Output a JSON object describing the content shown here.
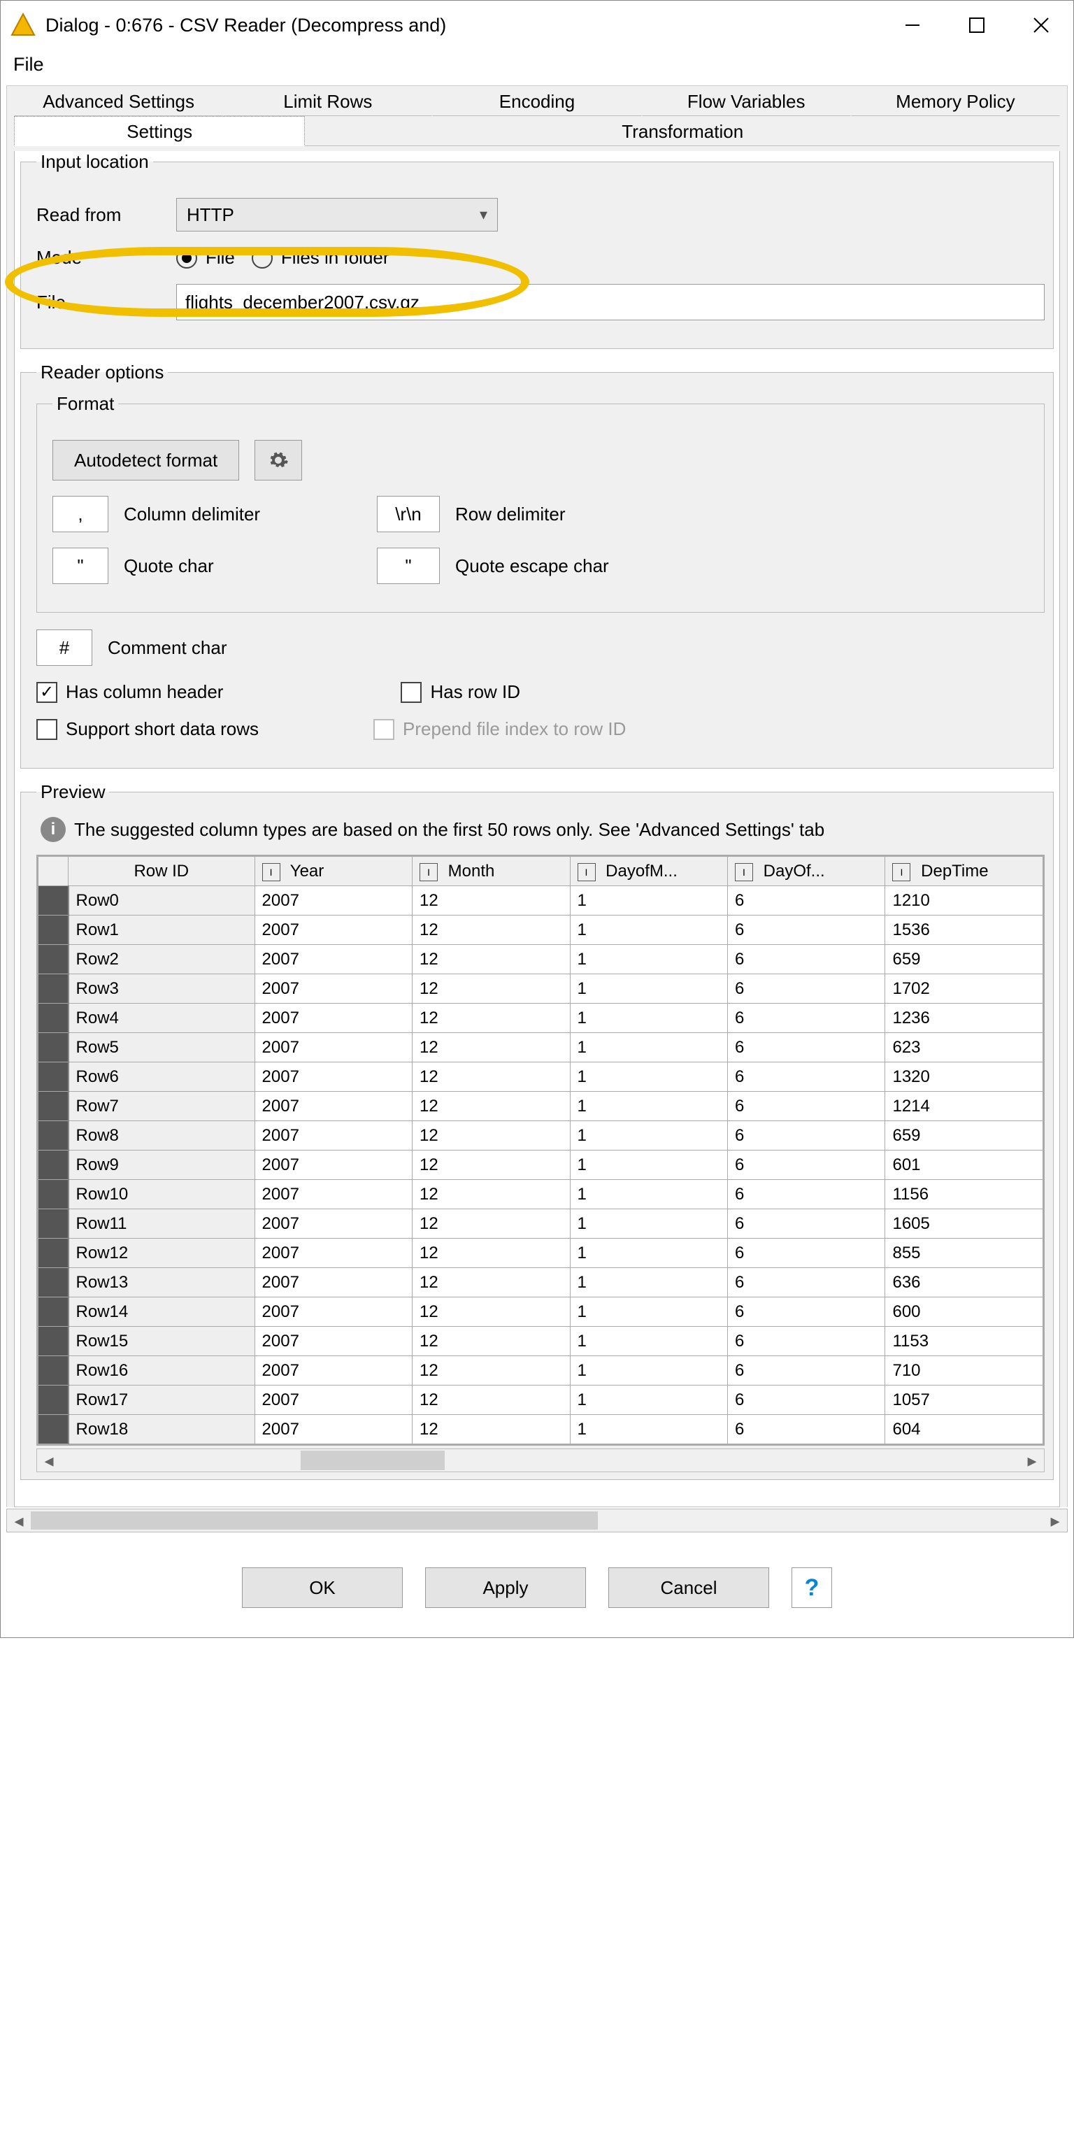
{
  "window": {
    "title": "Dialog - 0:676 - CSV Reader (Decompress and)"
  },
  "menubar": {
    "file": "File"
  },
  "tabs": {
    "row1": [
      "Advanced Settings",
      "Limit Rows",
      "Encoding",
      "Flow Variables",
      "Memory Policy"
    ],
    "row2": {
      "settings": "Settings",
      "transformation": "Transformation"
    }
  },
  "input_location": {
    "legend": "Input location",
    "read_from_label": "Read from",
    "read_from_value": "HTTP",
    "mode_label": "Mode",
    "mode_file": "File",
    "mode_files_in_folder": "Files in folder",
    "file_label": "File",
    "file_value": "flights_december2007.csv.gz"
  },
  "reader_options": {
    "legend": "Reader options",
    "format_legend": "Format",
    "autodetect": "Autodetect format",
    "col_delim_val": ",",
    "col_delim_lab": "Column delimiter",
    "row_delim_val": "\\r\\n",
    "row_delim_lab": "Row delimiter",
    "quote_val": "\"",
    "quote_lab": "Quote char",
    "quote_esc_val": "\"",
    "quote_esc_lab": "Quote escape char",
    "comment_val": "#",
    "comment_lab": "Comment char",
    "has_header": "Has column header",
    "has_rowid": "Has row ID",
    "support_short": "Support short data rows",
    "prepend_idx": "Prepend file index to row ID"
  },
  "preview": {
    "legend": "Preview",
    "note": "The suggested column types are based on the first 50 rows only. See 'Advanced Settings' tab",
    "columns": [
      "Row ID",
      "Year",
      "Month",
      "DayofM...",
      "DayOf...",
      "DepTime"
    ],
    "rows": [
      {
        "id": "Row0",
        "c": [
          "2007",
          "12",
          "1",
          "6",
          "1210"
        ]
      },
      {
        "id": "Row1",
        "c": [
          "2007",
          "12",
          "1",
          "6",
          "1536"
        ]
      },
      {
        "id": "Row2",
        "c": [
          "2007",
          "12",
          "1",
          "6",
          "659"
        ]
      },
      {
        "id": "Row3",
        "c": [
          "2007",
          "12",
          "1",
          "6",
          "1702"
        ]
      },
      {
        "id": "Row4",
        "c": [
          "2007",
          "12",
          "1",
          "6",
          "1236"
        ]
      },
      {
        "id": "Row5",
        "c": [
          "2007",
          "12",
          "1",
          "6",
          "623"
        ]
      },
      {
        "id": "Row6",
        "c": [
          "2007",
          "12",
          "1",
          "6",
          "1320"
        ]
      },
      {
        "id": "Row7",
        "c": [
          "2007",
          "12",
          "1",
          "6",
          "1214"
        ]
      },
      {
        "id": "Row8",
        "c": [
          "2007",
          "12",
          "1",
          "6",
          "659"
        ]
      },
      {
        "id": "Row9",
        "c": [
          "2007",
          "12",
          "1",
          "6",
          "601"
        ]
      },
      {
        "id": "Row10",
        "c": [
          "2007",
          "12",
          "1",
          "6",
          "1156"
        ]
      },
      {
        "id": "Row11",
        "c": [
          "2007",
          "12",
          "1",
          "6",
          "1605"
        ]
      },
      {
        "id": "Row12",
        "c": [
          "2007",
          "12",
          "1",
          "6",
          "855"
        ]
      },
      {
        "id": "Row13",
        "c": [
          "2007",
          "12",
          "1",
          "6",
          "636"
        ]
      },
      {
        "id": "Row14",
        "c": [
          "2007",
          "12",
          "1",
          "6",
          "600"
        ]
      },
      {
        "id": "Row15",
        "c": [
          "2007",
          "12",
          "1",
          "6",
          "1153"
        ]
      },
      {
        "id": "Row16",
        "c": [
          "2007",
          "12",
          "1",
          "6",
          "710"
        ]
      },
      {
        "id": "Row17",
        "c": [
          "2007",
          "12",
          "1",
          "6",
          "1057"
        ]
      },
      {
        "id": "Row18",
        "c": [
          "2007",
          "12",
          "1",
          "6",
          "604"
        ]
      }
    ]
  },
  "footer": {
    "ok": "OK",
    "apply": "Apply",
    "cancel": "Cancel"
  }
}
